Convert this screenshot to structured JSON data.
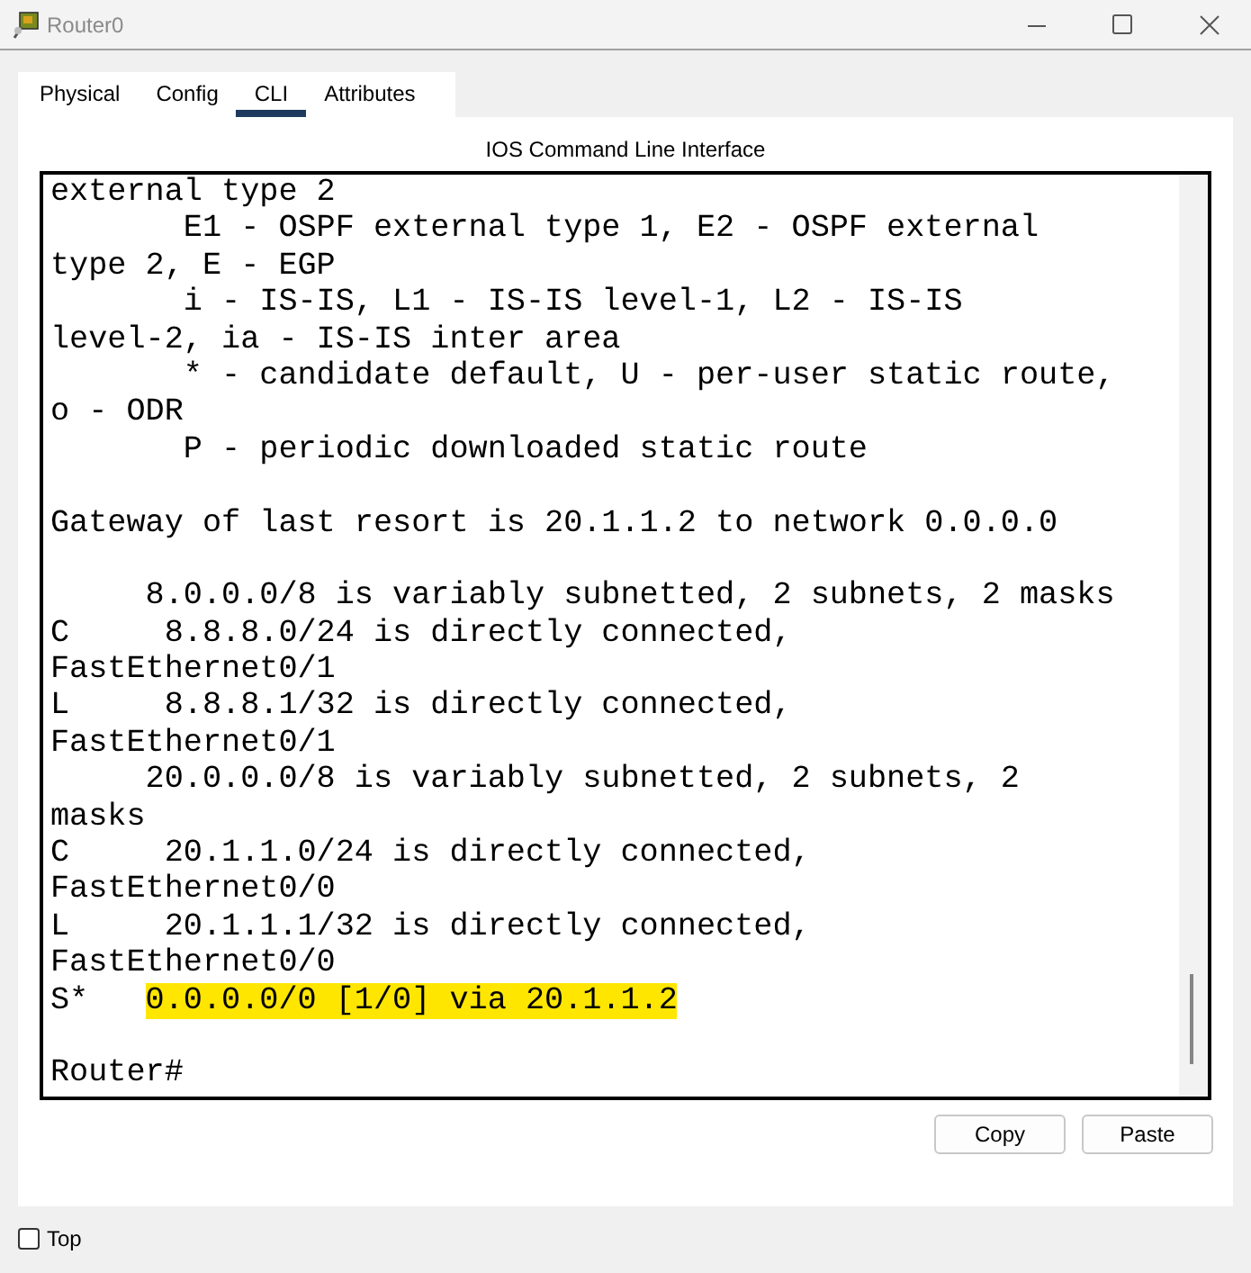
{
  "window": {
    "title": "Router0"
  },
  "tabs": [
    {
      "label": "Physical",
      "selected": false
    },
    {
      "label": "Config",
      "selected": false
    },
    {
      "label": "CLI",
      "selected": true
    },
    {
      "label": "Attributes",
      "selected": false
    }
  ],
  "panel_title": "IOS Command Line Interface",
  "terminal": {
    "lines": [
      {
        "kind": "text",
        "text": "external type 2"
      },
      {
        "kind": "text",
        "text": "       E1 - OSPF external type 1, E2 - OSPF external"
      },
      {
        "kind": "text",
        "text": "type 2, E - EGP"
      },
      {
        "kind": "text",
        "text": "       i - IS-IS, L1 - IS-IS level-1, L2 - IS-IS"
      },
      {
        "kind": "text",
        "text": "level-2, ia - IS-IS inter area"
      },
      {
        "kind": "text",
        "text": "       * - candidate default, U - per-user static route,"
      },
      {
        "kind": "text",
        "text": "o - ODR"
      },
      {
        "kind": "text",
        "text": "       P - periodic downloaded static route"
      },
      {
        "kind": "blank"
      },
      {
        "kind": "text",
        "text": "Gateway of last resort is 20.1.1.2 to network 0.0.0.0"
      },
      {
        "kind": "blank"
      },
      {
        "kind": "text",
        "text": "     8.0.0.0/8 is variably subnetted, 2 subnets, 2 masks"
      },
      {
        "kind": "text",
        "text": "C     8.8.8.0/24 is directly connected,"
      },
      {
        "kind": "text",
        "text": "FastEthernet0/1"
      },
      {
        "kind": "text",
        "text": "L     8.8.8.1/32 is directly connected,"
      },
      {
        "kind": "text",
        "text": "FastEthernet0/1"
      },
      {
        "kind": "text",
        "text": "     20.0.0.0/8 is variably subnetted, 2 subnets, 2"
      },
      {
        "kind": "text",
        "text": "masks"
      },
      {
        "kind": "text",
        "text": "C     20.1.1.0/24 is directly connected,"
      },
      {
        "kind": "text",
        "text": "FastEthernet0/0"
      },
      {
        "kind": "text",
        "text": "L     20.1.1.1/32 is directly connected,"
      },
      {
        "kind": "text",
        "text": "FastEthernet0/0"
      },
      {
        "kind": "highlight",
        "text": "S*   ",
        "highlighted": "0.0.0.0/0 [1/0] via 20.1.1.2"
      },
      {
        "kind": "blank"
      },
      {
        "kind": "text",
        "text": "Router#"
      }
    ]
  },
  "buttons": [
    "Copy",
    "Paste"
  ],
  "top_checkbox": {
    "label": "Top",
    "checked": false
  }
}
